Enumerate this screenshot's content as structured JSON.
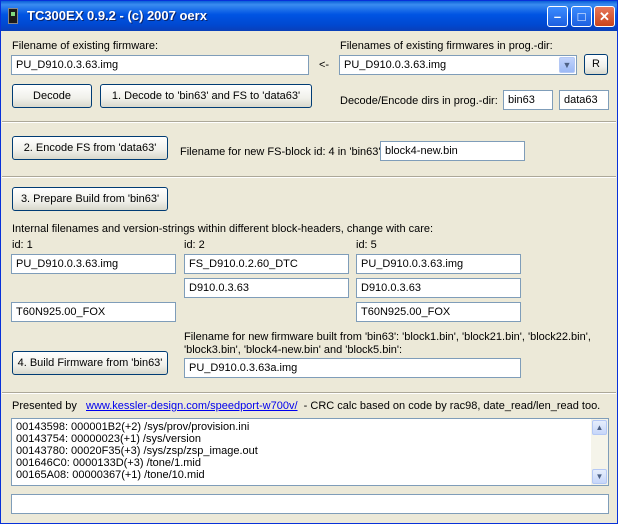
{
  "window": {
    "title": "TC300EX 0.9.2 - (c) 2007 oerx",
    "min_glyph": "–",
    "max_glyph": "□",
    "close_glyph": "✕"
  },
  "firmware": {
    "label": "Filename of existing firmware:",
    "value": "PU_D910.0.3.63.img",
    "arrow": "<-",
    "list_label": "Filenames of existing firmwares in prog.-dir:",
    "list_value": "PU_D910.0.3.63.img",
    "refresh_label": "R"
  },
  "buttons": {
    "decode": "Decode",
    "decode_to": "1. Decode to 'bin63' and FS to 'data63'",
    "encode_fs": "2. Encode FS from 'data63'",
    "prepare": "3. Prepare Build from 'bin63'",
    "build": "4. Build Firmware from 'bin63'"
  },
  "dirs": {
    "label": "Decode/Encode dirs in prog.-dir:",
    "bin": "bin63",
    "data": "data63"
  },
  "fs_block": {
    "label": "Filename for new FS-block id: 4 in 'bin63':",
    "value": "block4-new.bin"
  },
  "headers": {
    "note": "Internal filenames and version-strings within different block-headers, change with care:",
    "id1_label": "id: 1",
    "id2_label": "id: 2",
    "id5_label": "id: 5",
    "id1_name": "PU_D910.0.3.63.img",
    "id1_code": "T60N925.00_FOX",
    "id2_name": "FS_D910.0.2.60_DTC",
    "id2_version": "D910.0.3.63",
    "id5_name": "PU_D910.0.3.63.img",
    "id5_version": "D910.0.3.63",
    "id5_code": "T60N925.00_FOX"
  },
  "build": {
    "label_line1": "Filename for new firmware built from 'bin63': 'block1.bin', 'block21.bin', 'block22.bin',",
    "label_line2": "'block3.bin', 'block4-new.bin' and 'block5.bin':",
    "value": "PU_D910.0.3.63a.img"
  },
  "credits": {
    "prefix": "Presented by",
    "link": "www.kessler-design.com/speedport-w700v/",
    "suffix": "- CRC calc based on code by rac98, date_read/len_read too."
  },
  "log": [
    "00143598: 000001B2(+2) /sys/prov/provision.ini",
    "00143754: 00000023(+1) /sys/version",
    "00143780: 00020F35(+3) /sys/zsp/zsp_image.out",
    "001646C0: 0000133D(+3) /tone/1.mid",
    "00165A08: 00000367(+1) /tone/10.mid"
  ],
  "scroll": {
    "up": "▲",
    "down": "▼"
  },
  "combo_arrow": "▼",
  "status": ""
}
